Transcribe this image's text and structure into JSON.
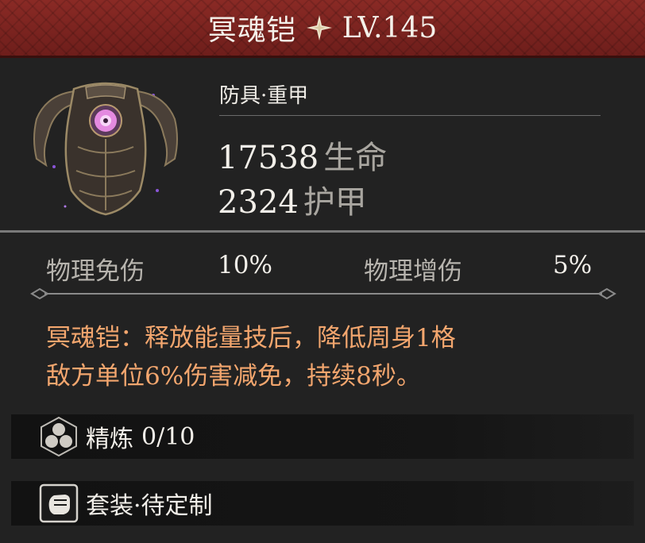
{
  "item": {
    "name": "冥魂铠",
    "level": "LV.145",
    "type": "防具·重甲",
    "main_stats": [
      {
        "value": "17538",
        "label": "生命"
      },
      {
        "value": "2324",
        "label": "护甲"
      }
    ],
    "sub_stats": [
      {
        "label": "物理免伤",
        "value": "10%"
      },
      {
        "label": "物理增伤",
        "value": "5%"
      }
    ],
    "description_lines": [
      "冥魂铠：释放能量技后，降低周身1格",
      "敌方单位6%伤害减免，持续8秒。"
    ],
    "refine": {
      "label": "精炼",
      "value": "0/10"
    },
    "set_label": "套装·待定制"
  },
  "colors": {
    "header": "#7a2420",
    "description": "#f3a66e",
    "stat_label": "#a9a6a0"
  },
  "icons": {
    "title_star": "four-point-star-icon",
    "item": "heavy-armor-icon",
    "refine": "hexagon-cluster-icon",
    "set": "fist-badge-icon"
  }
}
